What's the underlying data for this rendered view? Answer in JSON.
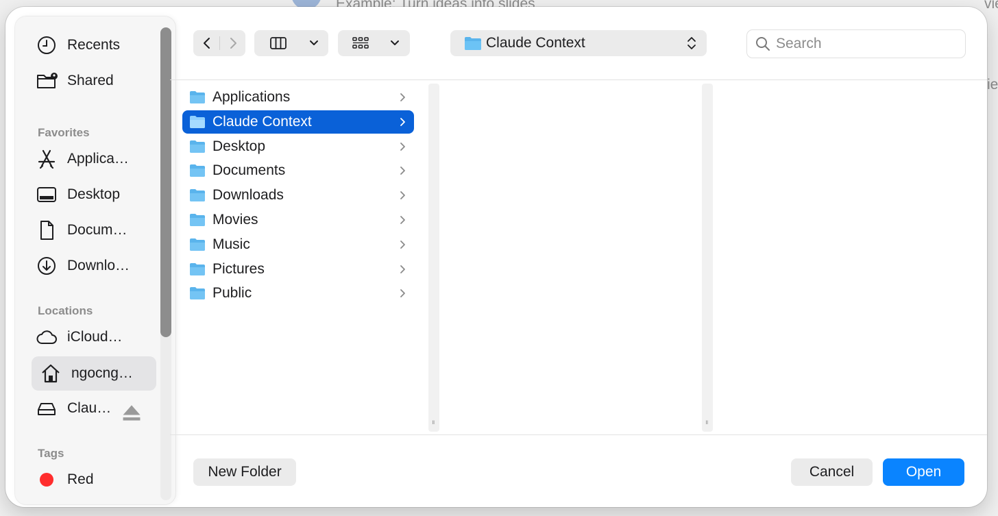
{
  "background": {
    "title": "Example: Turn ideas into slides",
    "right_text": "vie",
    "right_text2": "ie"
  },
  "sidebar": {
    "top_items": [
      {
        "label": "Recents",
        "icon": "clock-icon"
      },
      {
        "label": "Shared",
        "icon": "shared-folder-icon"
      }
    ],
    "favorites_heading": "Favorites",
    "favorites": [
      {
        "label": "Applica…",
        "icon": "applications-icon"
      },
      {
        "label": "Desktop",
        "icon": "desktop-icon"
      },
      {
        "label": "Docum…",
        "icon": "document-icon"
      },
      {
        "label": "Downlo…",
        "icon": "download-icon"
      }
    ],
    "locations_heading": "Locations",
    "locations": [
      {
        "label": "iCloud…",
        "icon": "cloud-icon"
      },
      {
        "label": "ngocng…",
        "icon": "home-icon",
        "selected": true
      },
      {
        "label": "Clau…",
        "icon": "disk-icon"
      }
    ],
    "tags_heading": "Tags",
    "tags": [
      {
        "label": "Red",
        "color": "#ff2d2d"
      }
    ]
  },
  "toolbar": {
    "path_folder": "Claude Context",
    "search_placeholder": "Search"
  },
  "browser": {
    "items": [
      {
        "label": "Applications",
        "selected": false
      },
      {
        "label": "Claude Context",
        "selected": true
      },
      {
        "label": "Desktop",
        "selected": false
      },
      {
        "label": "Documents",
        "selected": false
      },
      {
        "label": "Downloads",
        "selected": false
      },
      {
        "label": "Movies",
        "selected": false
      },
      {
        "label": "Music",
        "selected": false
      },
      {
        "label": "Pictures",
        "selected": false
      },
      {
        "label": "Public",
        "selected": false
      }
    ]
  },
  "footer": {
    "new_folder": "New Folder",
    "cancel": "Cancel",
    "open": "Open"
  },
  "colors": {
    "accent": "#0a84ff",
    "selection": "#0a61d8",
    "folder": "#5ab4ec"
  }
}
